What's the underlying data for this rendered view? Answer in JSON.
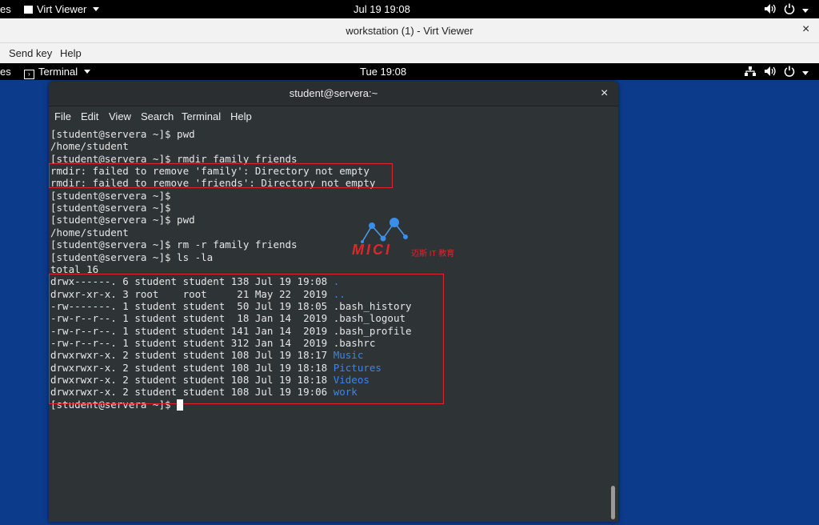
{
  "host_bar": {
    "activities_partial": "es",
    "app_name": "Virt Viewer",
    "clock": "Jul 19  19:08",
    "volume_icon": "volume-icon",
    "power_icon": "power-icon"
  },
  "vv_window": {
    "title": "workstation (1) - Virt Viewer",
    "close_label": "×",
    "menu": [
      "Send key",
      "Help"
    ]
  },
  "guest_bar": {
    "activities_partial": "es",
    "app_name": "Terminal",
    "clock": "Tue 19:08"
  },
  "terminal": {
    "title": "student@servera:~",
    "close_label": "×",
    "menu": [
      "File",
      "Edit",
      "View",
      "Search",
      "Terminal",
      "Help"
    ],
    "lines": [
      {
        "text": "[student@servera ~]$ pwd"
      },
      {
        "text": "/home/student"
      },
      {
        "text": "[student@servera ~]$ rmdir family friends"
      },
      {
        "text": "rmdir: failed to remove 'family': Directory not empty"
      },
      {
        "text": "rmdir: failed to remove 'friends': Directory not empty"
      },
      {
        "text": "[student@servera ~]$"
      },
      {
        "text": "[student@servera ~]$"
      },
      {
        "text": "[student@servera ~]$ pwd"
      },
      {
        "text": "/home/student"
      },
      {
        "text": "[student@servera ~]$ rm -r family friends"
      },
      {
        "text": "[student@servera ~]$ ls -la"
      },
      {
        "text": "total 16"
      },
      {
        "text": "drwx------. 6 student student 138 Jul 19 19:08 ",
        "name": "."
      },
      {
        "text": "drwxr-xr-x. 3 root    root     21 May 22  2019 ",
        "name": ".."
      },
      {
        "text": "-rw-------. 1 student student  50 Jul 19 18:05 .bash_history"
      },
      {
        "text": "-rw-r--r--. 1 student student  18 Jan 14  2019 .bash_logout"
      },
      {
        "text": "-rw-r--r--. 1 student student 141 Jan 14  2019 .bash_profile"
      },
      {
        "text": "-rw-r--r--. 1 student student 312 Jan 14  2019 .bashrc"
      },
      {
        "text": "drwxrwxr-x. 2 student student 108 Jul 19 18:17 ",
        "name": "Music"
      },
      {
        "text": "drwxrwxr-x. 2 student student 108 Jul 19 18:18 ",
        "name": "Pictures"
      },
      {
        "text": "drwxrwxr-x. 2 student student 108 Jul 19 18:18 ",
        "name": "Videos"
      },
      {
        "text": "drwxrwxr-x. 2 student student 108 Jul 19 19:06 ",
        "name": "work"
      },
      {
        "text": "[student@servera ~]$ "
      }
    ]
  },
  "watermark": {
    "logo_text": "MICI",
    "sub_text": "迈斯 IT 教育"
  },
  "colors": {
    "desktop_bg": "#0d3b8c",
    "terminal_bg": "#2e3436",
    "dir_blue": "#3a84f0",
    "highlight_red": "#e0262b"
  }
}
